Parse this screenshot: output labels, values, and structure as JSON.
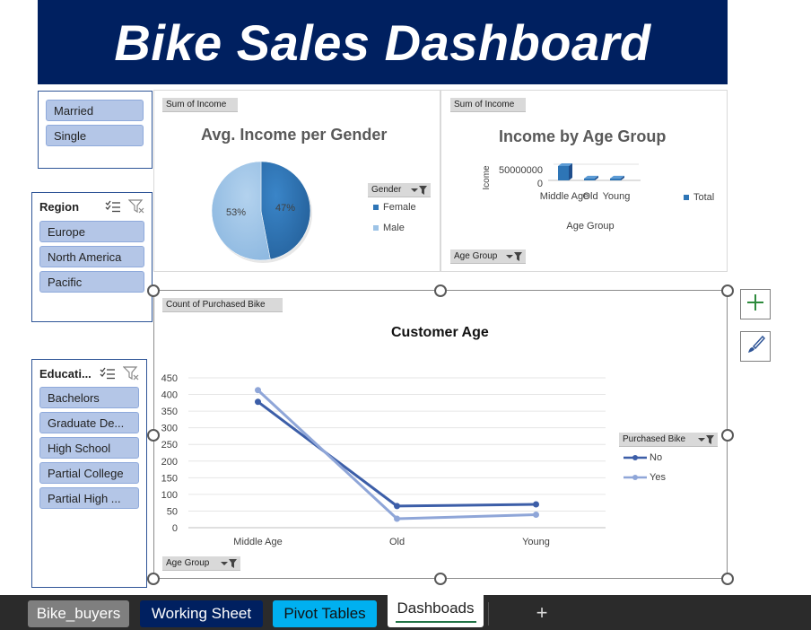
{
  "banner": {
    "title": "Bike Sales Dashboard"
  },
  "colors": {
    "banner_bg": "#002060",
    "slicer_item": "#b4c6e7",
    "female": "#2e75b6",
    "male": "#9dc3e6",
    "line_no": "#3c5ea8",
    "line_yes": "#8fa6d8"
  },
  "slicers": {
    "marital": {
      "items": [
        "Married",
        "Single"
      ]
    },
    "region": {
      "title": "Region",
      "items": [
        "Europe",
        "North America",
        "Pacific"
      ]
    },
    "education": {
      "title": "Educati...",
      "items": [
        "Bachelors",
        "Graduate De...",
        "High School",
        "Partial College",
        "Partial High ..."
      ]
    },
    "icons": {
      "multiselect": "multi-select-icon",
      "clear_filter": "clear-filter-icon"
    }
  },
  "gender_chart": {
    "field_button": "Sum of Income",
    "title": "Avg. Income per Gender",
    "legend_button": "Gender",
    "legend": [
      "Female",
      "Male"
    ],
    "labels": [
      "47%",
      "53%"
    ]
  },
  "age_income_chart": {
    "field_button": "Sum of Income",
    "title": "Income by Age Group",
    "y_label": "Icome",
    "y_ticks": [
      "50000000",
      "0"
    ],
    "categories": [
      "Middle Age",
      "Old",
      "Young"
    ],
    "x_label": "Age Group",
    "legend": [
      "Total"
    ],
    "axis_button": "Age Group"
  },
  "customer_chart": {
    "field_button": "Count of Purchased Bike",
    "title": "Customer Age",
    "y_ticks": [
      "450",
      "400",
      "350",
      "300",
      "250",
      "200",
      "150",
      "100",
      "50",
      "0"
    ],
    "categories": [
      "Middle Age",
      "Old",
      "Young"
    ],
    "legend_button": "Purchased Bike",
    "legend": [
      "No",
      "Yes"
    ],
    "axis_button": "Age Group"
  },
  "chart_data": [
    {
      "type": "pie",
      "title": "Avg. Income per Gender",
      "categories": [
        "Female",
        "Male"
      ],
      "values": [
        47,
        53
      ],
      "unit": "%"
    },
    {
      "type": "bar",
      "title": "Income by Age Group",
      "ylabel": "Icome",
      "xlabel": "Age Group",
      "categories": [
        "Middle Age",
        "Old",
        "Young"
      ],
      "series": [
        {
          "name": "Total",
          "values": [
            15000000,
            2000000,
            2000000
          ]
        }
      ]
    },
    {
      "type": "line",
      "title": "Customer Age",
      "categories": [
        "Middle Age",
        "Old",
        "Young"
      ],
      "ylim": [
        0,
        450
      ],
      "series": [
        {
          "name": "No",
          "values": [
            378,
            65,
            70
          ]
        },
        {
          "name": "Yes",
          "values": [
            413,
            27,
            39
          ]
        }
      ]
    }
  ],
  "side_buttons": {
    "add": "plus-icon",
    "style": "brush-icon"
  },
  "tabs": [
    "Bike_buyers",
    "Working Sheet",
    "Pivot Tables",
    "Dashboads"
  ],
  "tabbar": {
    "add_sheet_icon": "+"
  }
}
